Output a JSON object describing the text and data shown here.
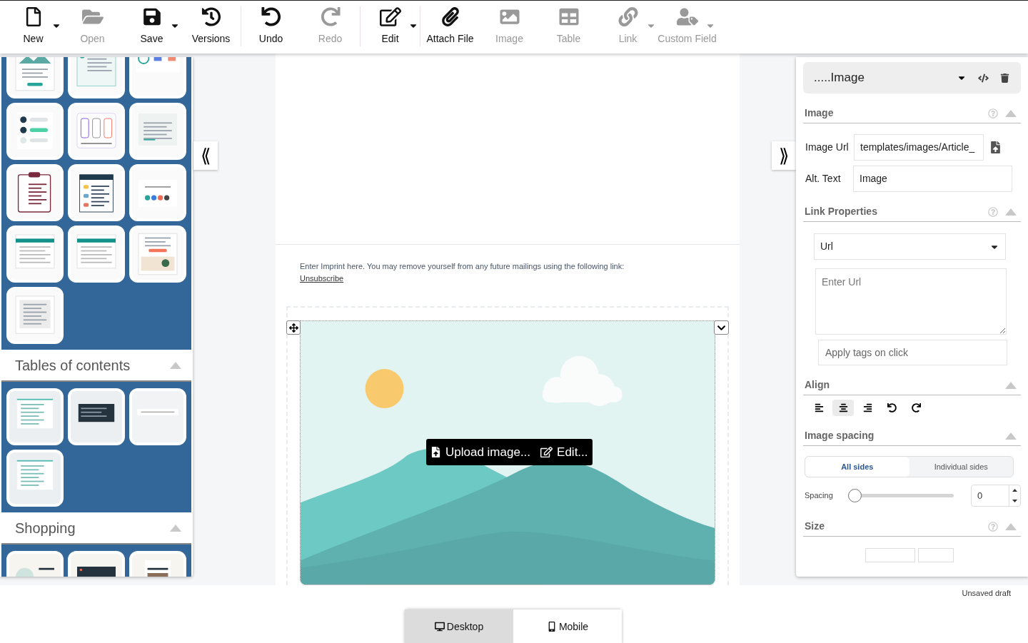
{
  "toolbar": {
    "groups": [
      [
        {
          "kind": "new",
          "label": "New",
          "disabled": false,
          "dropdown": true
        },
        {
          "kind": "open",
          "label": "Open",
          "disabled": true,
          "dropdown": false
        },
        {
          "kind": "save",
          "label": "Save",
          "disabled": false,
          "dropdown": true
        },
        {
          "kind": "versions",
          "label": "Versions",
          "disabled": false,
          "dropdown": false
        }
      ],
      [
        {
          "kind": "undo",
          "label": "Undo",
          "disabled": false,
          "dropdown": false
        },
        {
          "kind": "redo",
          "label": "Redo",
          "disabled": true,
          "dropdown": false
        }
      ],
      [
        {
          "kind": "edit",
          "label": "Edit",
          "disabled": false,
          "dropdown": true
        }
      ],
      [
        {
          "kind": "attach",
          "label": "Attach File",
          "disabled": false,
          "dropdown": false
        },
        {
          "kind": "image",
          "label": "Image",
          "disabled": true,
          "dropdown": false
        },
        {
          "kind": "table",
          "label": "Table",
          "disabled": true,
          "dropdown": false
        },
        {
          "kind": "link",
          "label": "Link",
          "disabled": true,
          "dropdown": true
        },
        {
          "kind": "custom",
          "label": "Custom Field",
          "disabled": true,
          "dropdown": true
        }
      ]
    ]
  },
  "sidebar": {
    "sections": [
      {
        "expanded": true,
        "templates": [
          {
            "kind": "hero"
          },
          {
            "kind": "info"
          },
          {
            "kind": "stats"
          },
          {
            "kind": "checklist"
          },
          {
            "kind": "cards"
          },
          {
            "kind": "quote"
          },
          {
            "kind": "clipboard"
          },
          {
            "kind": "list"
          },
          {
            "kind": "social"
          },
          {
            "kind": "icons"
          },
          {
            "kind": "table"
          },
          {
            "kind": "promo"
          },
          {
            "kind": "text"
          }
        ]
      },
      {
        "title": "Tables of contents",
        "expanded": true,
        "templates": [
          {
            "kind": "toc"
          },
          {
            "kind": "toc-dark"
          },
          {
            "kind": "toc-nav"
          },
          {
            "kind": "toc"
          }
        ]
      },
      {
        "title": "Shopping",
        "expanded": true,
        "templates": [
          {
            "kind": "shop"
          },
          {
            "kind": "shop-dark"
          },
          {
            "kind": "shop-photo"
          }
        ]
      }
    ]
  },
  "toggles": {
    "left": "⟪",
    "right": "⟫"
  },
  "canvas": {
    "imprint": "Enter Imprint here. You may remove yourself from any future mailings using the following link:",
    "link": "Unsubscribe",
    "overlay": {
      "upload": "Upload image...",
      "edit": "Edit..."
    }
  },
  "properties": {
    "element": ".....Image",
    "image_section": {
      "title": "Image",
      "help": true,
      "expanded": true,
      "url_label": "Image Url",
      "url": "templates/images/Article_",
      "alt_label": "Alt. Text",
      "alt": "Image"
    },
    "link_section": {
      "title": "Link Properties",
      "help": true,
      "expanded": true,
      "type": "Url",
      "url_placeholder": "Enter Url",
      "tags_placeholder": "Apply tags on click"
    },
    "align_section": {
      "title": "Align",
      "help": false,
      "expanded": true,
      "buttons": [
        {
          "kind": "left",
          "selected": false
        },
        {
          "kind": "center",
          "selected": true
        },
        {
          "kind": "right",
          "selected": false
        },
        {
          "kind": "undo",
          "selected": false
        },
        {
          "kind": "redo",
          "selected": false
        }
      ]
    },
    "spacing_section": {
      "title": "Image spacing",
      "help": false,
      "expanded": true,
      "tabs": [
        {
          "label": "All sides",
          "selected": true
        },
        {
          "label": "Individual sides",
          "selected": false
        }
      ],
      "slider_label": "Spacing",
      "level": 0,
      "value": "0"
    },
    "size_section": {
      "title": "Size",
      "help": true,
      "expanded": true
    }
  },
  "status": "Unsaved draft",
  "devices": [
    {
      "kind": "desktop",
      "label": "Desktop",
      "selected": true
    },
    {
      "kind": "mobile",
      "label": "Mobile",
      "selected": false
    }
  ]
}
